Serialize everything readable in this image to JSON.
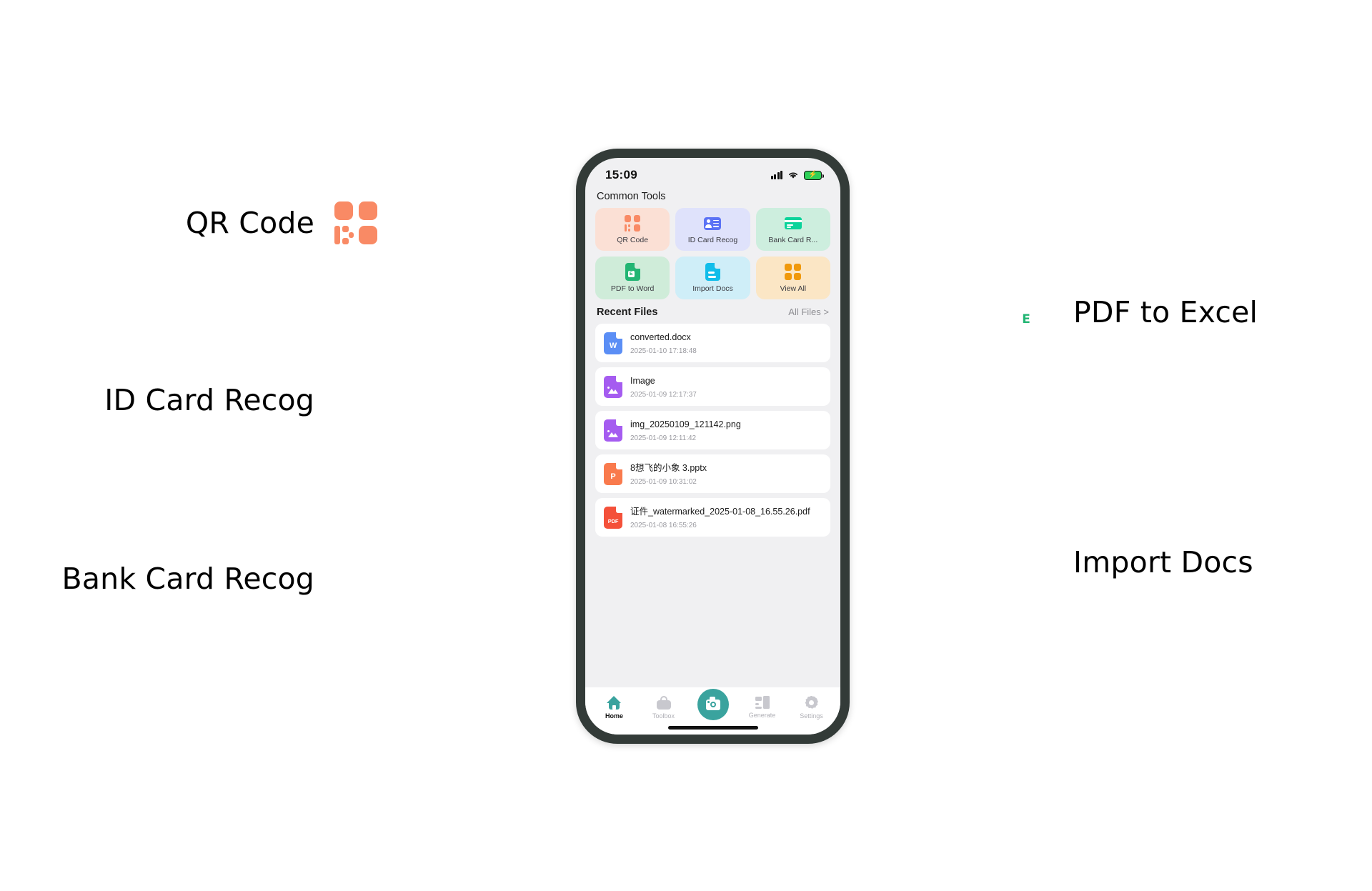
{
  "annotations": {
    "left": [
      {
        "label": "QR Code",
        "icon": "qr-code-icon",
        "color": "#f98a65"
      },
      {
        "label": "ID Card Recog",
        "icon": "id-card-icon",
        "color": "#5b72f5"
      },
      {
        "label": "Bank Card Recog",
        "icon": "bank-card-icon",
        "color": "#0ad39a"
      }
    ],
    "right": [
      {
        "label": "PDF to Excel",
        "icon": "excel-doc-icon",
        "color": "#22b573",
        "letter": "E"
      },
      {
        "label": "Import Docs",
        "icon": "import-doc-icon",
        "color": "#11bdea"
      }
    ]
  },
  "phone": {
    "statusbar": {
      "time": "15:09",
      "signal_icon": "signal-bars-icon",
      "wifi_icon": "wifi-icon",
      "battery_icon": "battery-charging-icon",
      "battery_color": "#2fd058"
    },
    "common_tools": {
      "title": "Common Tools",
      "items": [
        {
          "label": "QR Code",
          "icon": "qr-code-icon",
          "bg": "#fbe0d5",
          "fg": "#f98a65"
        },
        {
          "label": "ID Card Recog",
          "icon": "id-card-icon",
          "bg": "#dfe2fb",
          "fg": "#5b72f5"
        },
        {
          "label": "Bank Card R...",
          "icon": "bank-card-icon",
          "bg": "#cdeede",
          "fg": "#0ad39a"
        },
        {
          "label": "PDF to Word",
          "icon": "excel-doc-icon",
          "bg": "#cfecd9",
          "fg": "#22b573",
          "letter": "E"
        },
        {
          "label": "Import Docs",
          "icon": "import-doc-icon",
          "bg": "#cfeef8",
          "fg": "#11bdea"
        },
        {
          "label": "View All",
          "icon": "grid-icon",
          "bg": "#fbe6c5",
          "fg": "#f0990c"
        }
      ]
    },
    "recent_files": {
      "title": "Recent Files",
      "all_files_link": "All Files >",
      "items": [
        {
          "name": "converted.docx",
          "date": "2025-01-10 17:18:48",
          "icon": "word-file-icon",
          "color": "#5b8ef5",
          "tag": "W"
        },
        {
          "name": "Image",
          "date": "2025-01-09 12:17:37",
          "icon": "image-file-icon",
          "color": "#a55cf0",
          "tag": ""
        },
        {
          "name": "img_20250109_121142.png",
          "date": "2025-01-09 12:11:42",
          "icon": "image-file-icon",
          "color": "#a55cf0",
          "tag": ""
        },
        {
          "name": "8想飞的小象 3.pptx",
          "date": "2025-01-09 10:31:02",
          "icon": "powerpoint-file-icon",
          "color": "#f97a4d",
          "tag": "P"
        },
        {
          "name": "证件_watermarked_2025-01-08_16.55.26.pdf",
          "date": "2025-01-08 16:55:26",
          "icon": "pdf-file-icon",
          "color": "#f4513a",
          "tag": "PDF"
        }
      ]
    },
    "tabbar": {
      "accent": "#3aa39e",
      "items": [
        {
          "label": "Home",
          "icon": "home-icon",
          "active": true
        },
        {
          "label": "Toolbox",
          "icon": "toolbox-icon",
          "active": false
        },
        {
          "label": "Generate",
          "icon": "generate-icon",
          "active": false
        },
        {
          "label": "Settings",
          "icon": "gear-icon",
          "active": false
        }
      ],
      "fab_icon": "camera-icon"
    }
  }
}
